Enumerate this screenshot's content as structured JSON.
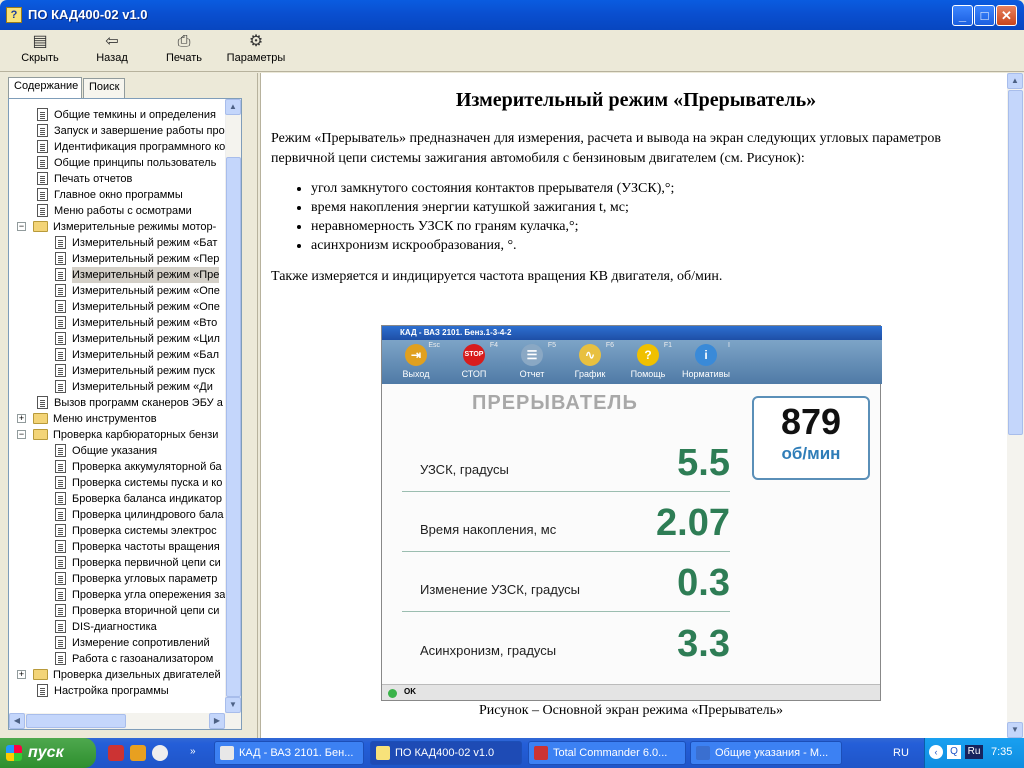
{
  "window": {
    "title": "ПО КАД400-02 v1.0"
  },
  "toolbar": [
    {
      "label": "Скрыть",
      "icon": "hide-icon"
    },
    {
      "label": "Назад",
      "icon": "back-arrow-icon"
    },
    {
      "label": "Печать",
      "icon": "printer-icon"
    },
    {
      "label": "Параметры",
      "icon": "options-icon"
    }
  ],
  "tabs": [
    "Содержание",
    "Поиск"
  ],
  "tree": [
    {
      "label": "Общие темкины и определения",
      "level": 1,
      "type": "page"
    },
    {
      "label": "Запуск и завершение работы про",
      "level": 1,
      "type": "page"
    },
    {
      "label": "Идентификация программного ко",
      "level": 1,
      "type": "page"
    },
    {
      "label": "Общие принципы пользователь",
      "level": 1,
      "type": "page"
    },
    {
      "label": "Печать отчетов",
      "level": 1,
      "type": "page"
    },
    {
      "label": "Главное окно программы",
      "level": 1,
      "type": "page"
    },
    {
      "label": "Меню работы с осмотрами",
      "level": 1,
      "type": "page"
    },
    {
      "label": "Измерительные режимы мотор-",
      "level": 0,
      "type": "folder",
      "toggle": "−"
    },
    {
      "label": "Измерительный режим «Бат",
      "level": 2,
      "type": "page"
    },
    {
      "label": "Измерительный режим «Пер",
      "level": 2,
      "type": "page"
    },
    {
      "label": "Измерительный режим «Пре",
      "level": 2,
      "type": "page",
      "selected": true
    },
    {
      "label": "Измерительный режим «Опе",
      "level": 2,
      "type": "page"
    },
    {
      "label": "Измерительный режим «Опе",
      "level": 2,
      "type": "page"
    },
    {
      "label": "Измерительный режим «Вто",
      "level": 2,
      "type": "page"
    },
    {
      "label": "Измерительный режим «Цил",
      "level": 2,
      "type": "page"
    },
    {
      "label": "Измерительный режим «Бал",
      "level": 2,
      "type": "page"
    },
    {
      "label": "Измерительный режим пуск",
      "level": 2,
      "type": "page"
    },
    {
      "label": "Измерительный режим «Ди",
      "level": 2,
      "type": "page"
    },
    {
      "label": "Вызов программ сканеров ЭБУ а",
      "level": 1,
      "type": "page"
    },
    {
      "label": "Меню инструментов",
      "level": 0,
      "type": "folder",
      "toggle": "+"
    },
    {
      "label": "Проверка карбюраторных бензи",
      "level": 0,
      "type": "folder",
      "toggle": "−"
    },
    {
      "label": "Общие указания",
      "level": 2,
      "type": "page"
    },
    {
      "label": "Проверка аккумуляторной ба",
      "level": 2,
      "type": "page"
    },
    {
      "label": "Проверка системы пуска и ко",
      "level": 2,
      "type": "page"
    },
    {
      "label": "Броверка баланса индикатор",
      "level": 2,
      "type": "page"
    },
    {
      "label": "Проверка цилиндрового бала",
      "level": 2,
      "type": "page"
    },
    {
      "label": "Проверка системы электрос",
      "level": 2,
      "type": "page"
    },
    {
      "label": "Проверка частоты вращения",
      "level": 2,
      "type": "page"
    },
    {
      "label": "Проверка первичной цепи си",
      "level": 2,
      "type": "page"
    },
    {
      "label": "Проверка угловых параметр",
      "level": 2,
      "type": "page"
    },
    {
      "label": "Проверка угла опережения за",
      "level": 2,
      "type": "page"
    },
    {
      "label": "Проверка вторичной цепи си",
      "level": 2,
      "type": "page"
    },
    {
      "label": "DIS-диагностика",
      "level": 2,
      "type": "page"
    },
    {
      "label": "Измерение сопротивлений",
      "level": 2,
      "type": "page"
    },
    {
      "label": "Работа с газоанализатором",
      "level": 2,
      "type": "page"
    },
    {
      "label": "Проверка дизельных двигателей",
      "level": 0,
      "type": "folder",
      "toggle": "+"
    },
    {
      "label": "Настройка программы",
      "level": 1,
      "type": "page"
    }
  ],
  "doc": {
    "heading": "Измерительный режим «Прерыватель»",
    "intro": "Режим «Прерыватель» предназначен для измерения, расчета и вывода на экран следующих угловых параметров первичной цепи системы зажигания автомобиля с бензиновым двигателем (см. Рисунок):",
    "bullets": [
      "угол замкнутого состояния контактов прерывателя (УЗСК),°;",
      "время накопления энергии катушкой зажигания t, мс;",
      "неравномерность УЗСК по граням кулачка,°;",
      "асинхронизм искрообразования, °."
    ],
    "extra": "Также измеряется и индицируется частота вращения КВ двигателя, об/мин.",
    "caption": "Рисунок – Основной экран режима «Прерыватель»"
  },
  "figure": {
    "title": "КАД - ВАЗ 2101. Бенз.1-3-4-2",
    "buttons": [
      {
        "label": "Выход",
        "key": "Esc",
        "icon": "exit-door-icon",
        "color": "#e0a020"
      },
      {
        "label": "СТОП",
        "key": "F4",
        "icon": "stop-sign-icon",
        "color": "#d81c1c"
      },
      {
        "label": "Отчет",
        "key": "F5",
        "icon": "report-icon",
        "color": "#8aa8c4"
      },
      {
        "label": "График",
        "key": "F6",
        "icon": "graph-icon",
        "color": "#e8c040"
      },
      {
        "label": "Помощь",
        "key": "F1",
        "icon": "help-icon",
        "color": "#f0c000"
      },
      {
        "label": "Нормативы",
        "key": "I",
        "icon": "info-icon",
        "color": "#3a8ad8"
      }
    ],
    "mode_title": "ПРЕРЫВАТЕЛЬ",
    "rpm_value": "879",
    "rpm_unit": "об/мин",
    "measurements": [
      {
        "label": "УЗСК, градусы",
        "value": "5.5"
      },
      {
        "label": "Время накопления, мс",
        "value": "2.07"
      },
      {
        "label": "Изменение УЗСК, градусы",
        "value": "0.3"
      },
      {
        "label": "Асинхронизм, градусы",
        "value": "3.3"
      }
    ],
    "status": "OK"
  },
  "taskbar": {
    "start_label": "пуск",
    "tasks": [
      {
        "label": "КАД - ВАЗ 2101. Бен...",
        "active": false
      },
      {
        "label": "ПО КАД400-02 v1.0",
        "active": true
      },
      {
        "label": "Total Commander 6.0...",
        "active": false
      },
      {
        "label": "Общие указания - М...",
        "active": false
      }
    ],
    "lang": "RU",
    "tray_lang": "Ru",
    "clock": "7:35"
  }
}
